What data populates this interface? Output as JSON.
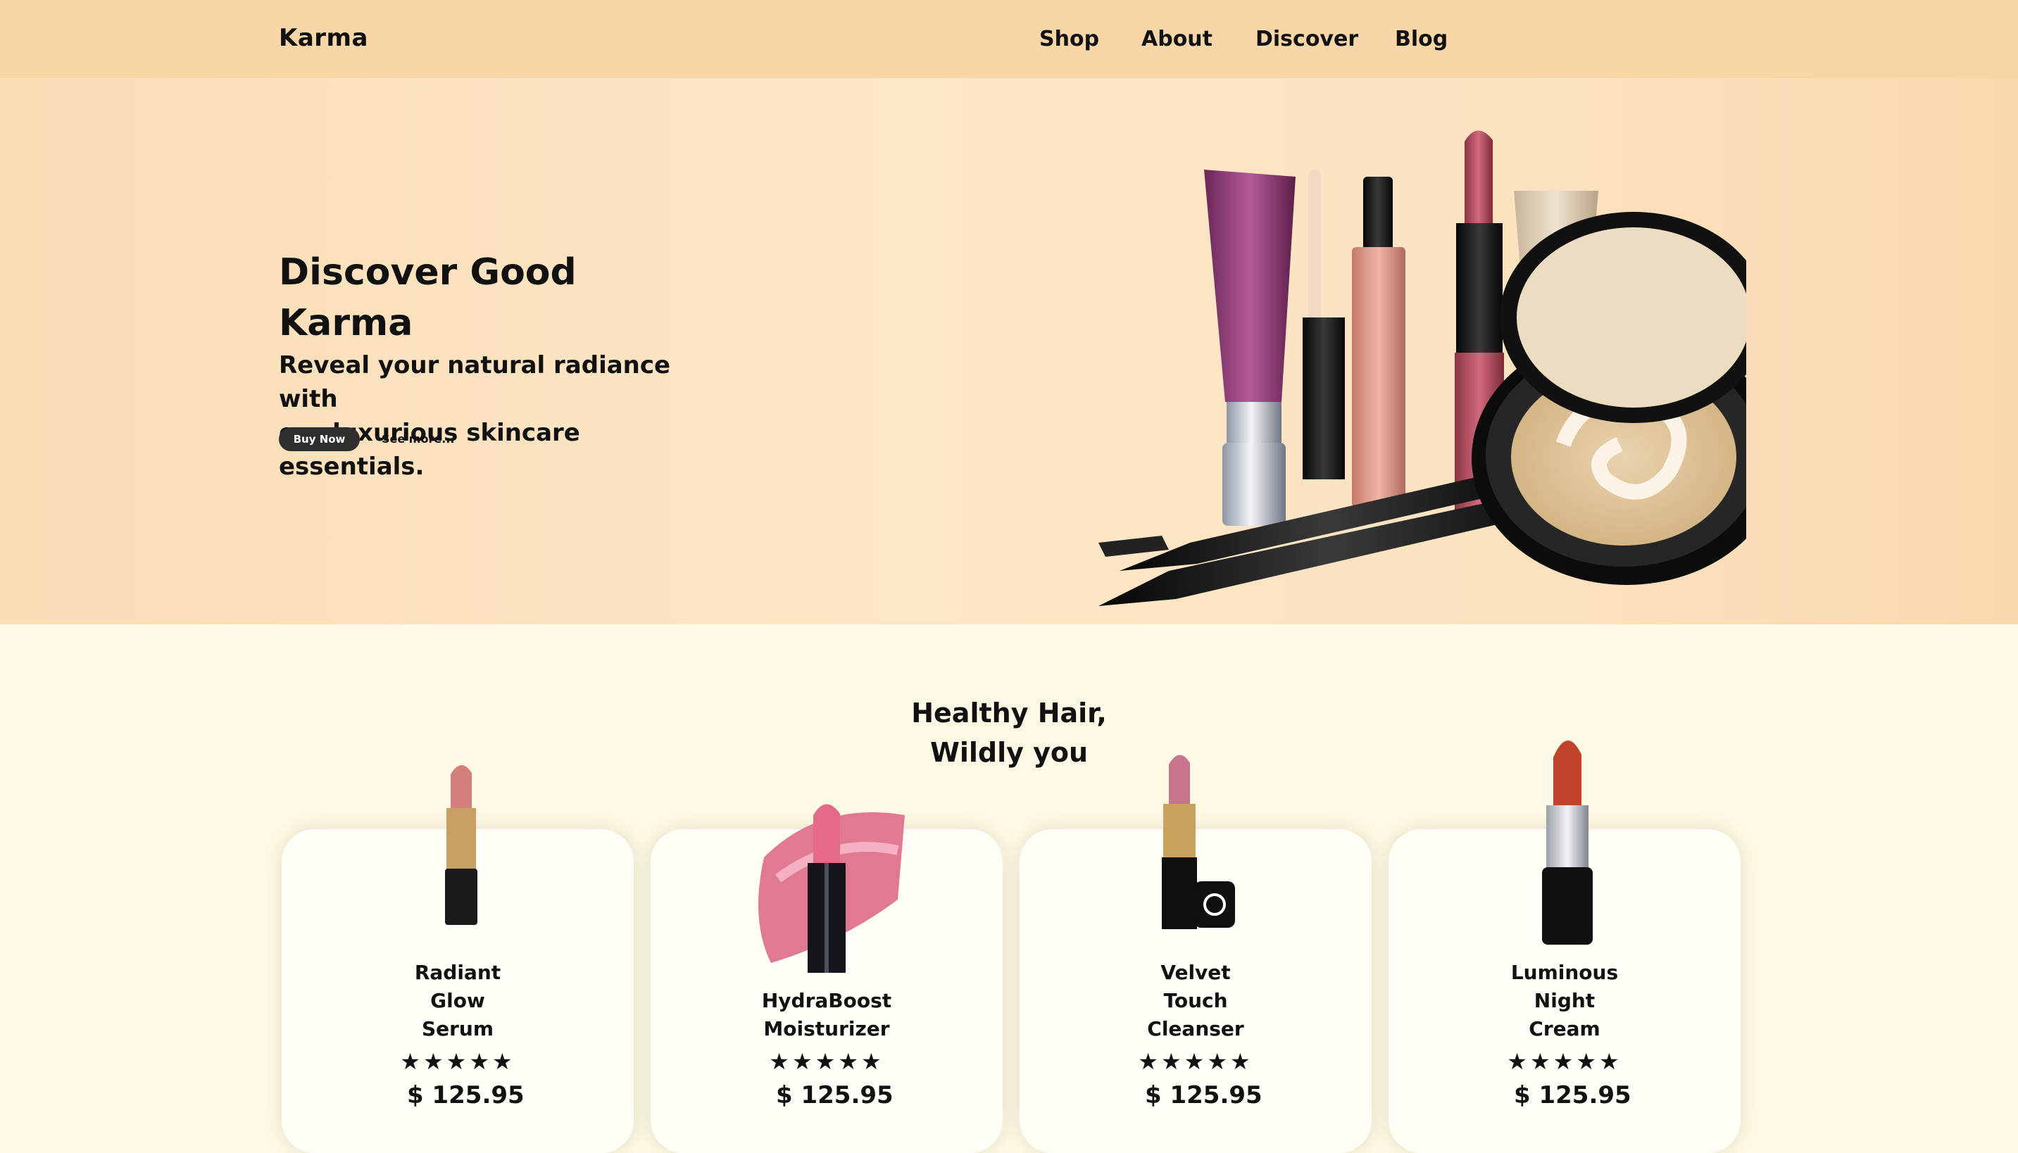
{
  "nav": {
    "brand": "Karma",
    "links": [
      "Shop",
      "About",
      "Discover",
      "Blog"
    ]
  },
  "hero": {
    "title_line1": "Discover Good",
    "title_line2": "Karma",
    "subtitle_line1": "Reveal your natural radiance with",
    "subtitle_line2": "our luxurious skincare essentials.",
    "buy_label": "Buy Now",
    "see_more_label": "See more..."
  },
  "featured": {
    "title_line1": "Healthy Hair,",
    "title_line2": "Wildly you",
    "products": [
      {
        "name": [
          "Radiant",
          "Glow",
          "Serum"
        ],
        "stars": "★★★★★",
        "rating": 5,
        "price": "$ 125.95"
      },
      {
        "name": [
          "HydraBoost",
          "Moisturizer"
        ],
        "stars": "★★★★★",
        "rating": 5,
        "price": "$ 125.95"
      },
      {
        "name": [
          "Velvet",
          "Touch",
          "Cleanser"
        ],
        "stars": "★★★★★",
        "rating": 5,
        "price": "$ 125.95"
      },
      {
        "name": [
          "Luminous",
          "Night",
          "Cream"
        ],
        "stars": "★★★★★",
        "rating": 5,
        "price": "$ 125.95"
      }
    ]
  },
  "colors": {
    "nav_bg": "#f8d6a8",
    "hero_bg": "#fce7c8",
    "page_bg": "#fdf9e4",
    "button_bg": "#2f2f2f"
  }
}
